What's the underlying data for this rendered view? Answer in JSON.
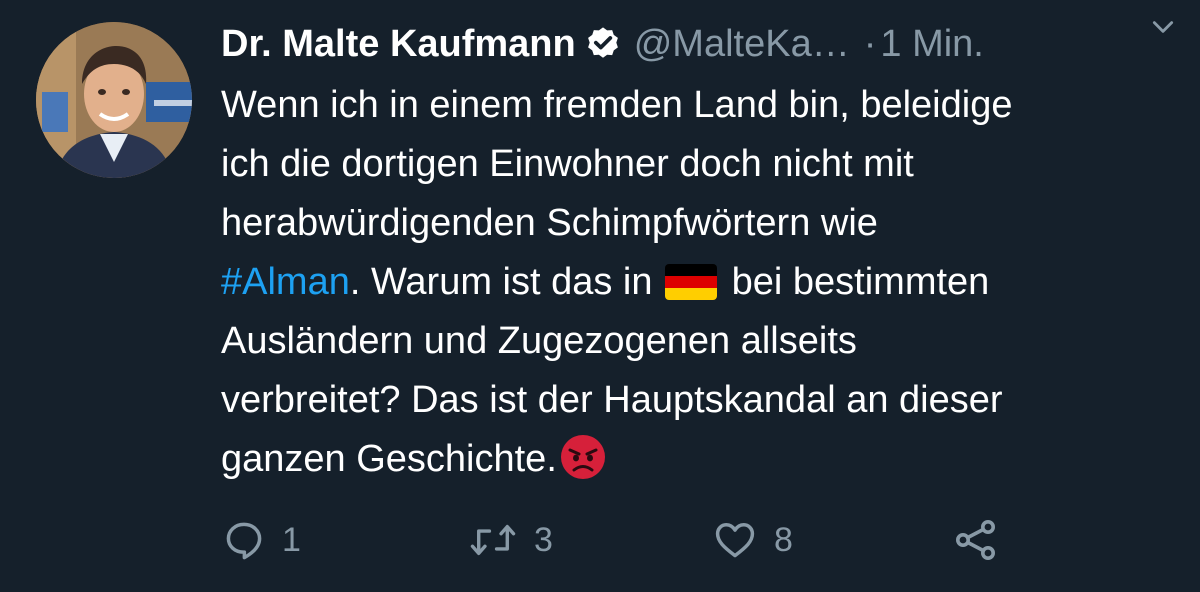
{
  "tweet": {
    "author": {
      "display_name": "Dr. Malte Kaufmann",
      "verified": true,
      "handle": "@MalteKa…",
      "separator": "·",
      "time": "1 Min."
    },
    "text_lines": [
      {
        "text": "Wenn ich in einem fremden Land bin, beleidige"
      },
      {
        "text": "ich die dortigen Einwohner doch nicht mit"
      },
      {
        "text": "herabwürdigenden Schimpfwörtern wie"
      },
      {
        "hashtag": "#Alman",
        "after_hashtag": ". Warum ist das in",
        "flag_emoji": "🇩🇪",
        "after_flag": "bei bestimmten"
      },
      {
        "text": "Ausländern und Zugezogenen allseits"
      },
      {
        "text": "verbreitet? Das ist der Hauptskandal an dieser"
      },
      {
        "text": "ganzen Geschichte.",
        "emoji": "😡"
      }
    ],
    "actions": {
      "reply": {
        "icon": "reply-icon",
        "count": "1"
      },
      "retweet": {
        "icon": "retweet-icon",
        "count": "3"
      },
      "like": {
        "icon": "heart-icon",
        "count": "8"
      },
      "share": {
        "icon": "share-icon"
      }
    }
  },
  "colors": {
    "background": "#15202b",
    "text": "#ffffff",
    "secondary": "#8899a6",
    "link": "#1da1f2"
  }
}
